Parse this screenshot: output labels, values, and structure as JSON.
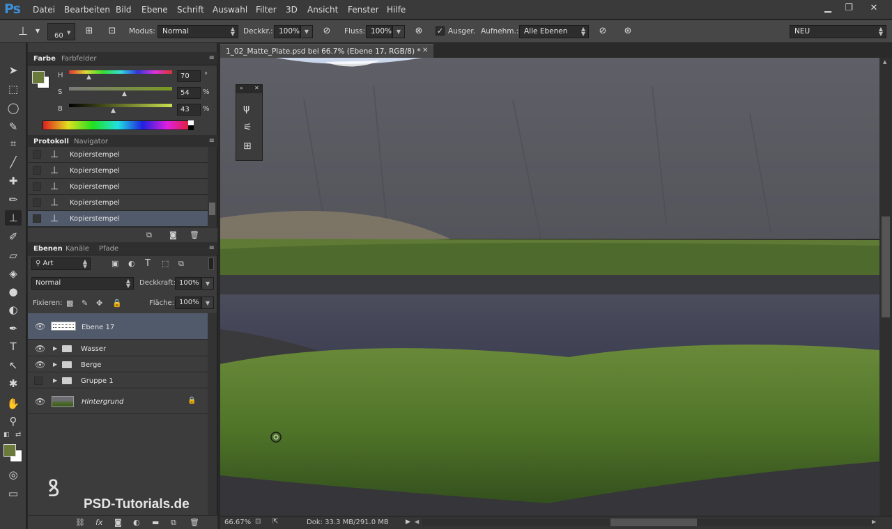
{
  "app": {
    "logo": "Ps"
  },
  "menu": [
    "Datei",
    "Bearbeiten",
    "Bild",
    "Ebene",
    "Schrift",
    "Auswahl",
    "Filter",
    "3D",
    "Ansicht",
    "Fenster",
    "Hilfe"
  ],
  "window_controls": {
    "minimize": "▁",
    "restore": "❐",
    "close": "✕"
  },
  "options": {
    "brush_size": "60",
    "modus_label": "Modus:",
    "modus_value": "Normal",
    "deckkr_label": "Deckkr.:",
    "deckkr_value": "100%",
    "fluss_label": "Fluss:",
    "fluss_value": "100%",
    "ausger_label": "Ausger.",
    "aufnehm_label": "Aufnehm.:",
    "aufnehm_value": "Alle Ebenen",
    "workspace_value": "NEU"
  },
  "color_panel": {
    "tabs": [
      "Farbe",
      "Farbfelder"
    ],
    "h_label": "H",
    "h_value": "70",
    "h_unit": "°",
    "s_label": "S",
    "s_value": "54",
    "s_unit": "%",
    "b_label": "B",
    "b_value": "43",
    "b_unit": "%",
    "foreground_color": "#6b7a3b",
    "background_color": "#ffffff"
  },
  "history_panel": {
    "tabs": [
      "Protokoll",
      "Navigator"
    ],
    "items": [
      "Kopierstempel",
      "Kopierstempel",
      "Kopierstempel",
      "Kopierstempel",
      "Kopierstempel"
    ],
    "selected_index": 4
  },
  "layers_panel": {
    "tabs": [
      "Ebenen",
      "Kanäle",
      "Pfade"
    ],
    "filter_value": "Art",
    "blend_mode": "Normal",
    "opacity_label": "Deckkraft:",
    "opacity_value": "100%",
    "lock_label": "Fixieren:",
    "fill_label": "Fläche:",
    "fill_value": "100%",
    "layers": [
      {
        "name": "Ebene 17",
        "type": "layer",
        "visible": true,
        "selected": true
      },
      {
        "name": "Wasser",
        "type": "group",
        "visible": true
      },
      {
        "name": "Berge",
        "type": "group",
        "visible": true
      },
      {
        "name": "Gruppe 1",
        "type": "group",
        "visible": false
      },
      {
        "name": "Hintergrund",
        "type": "background",
        "visible": true,
        "locked": true
      }
    ]
  },
  "document": {
    "tab_title": "1_02_Matte_Plate.psd bei 66.7% (Ebene 17, RGB/8) *",
    "zoom": "66.67%",
    "doc_size": "Dok: 33.3 MB/291.0 MB"
  },
  "watermark": "PSD-Tutorials.de"
}
